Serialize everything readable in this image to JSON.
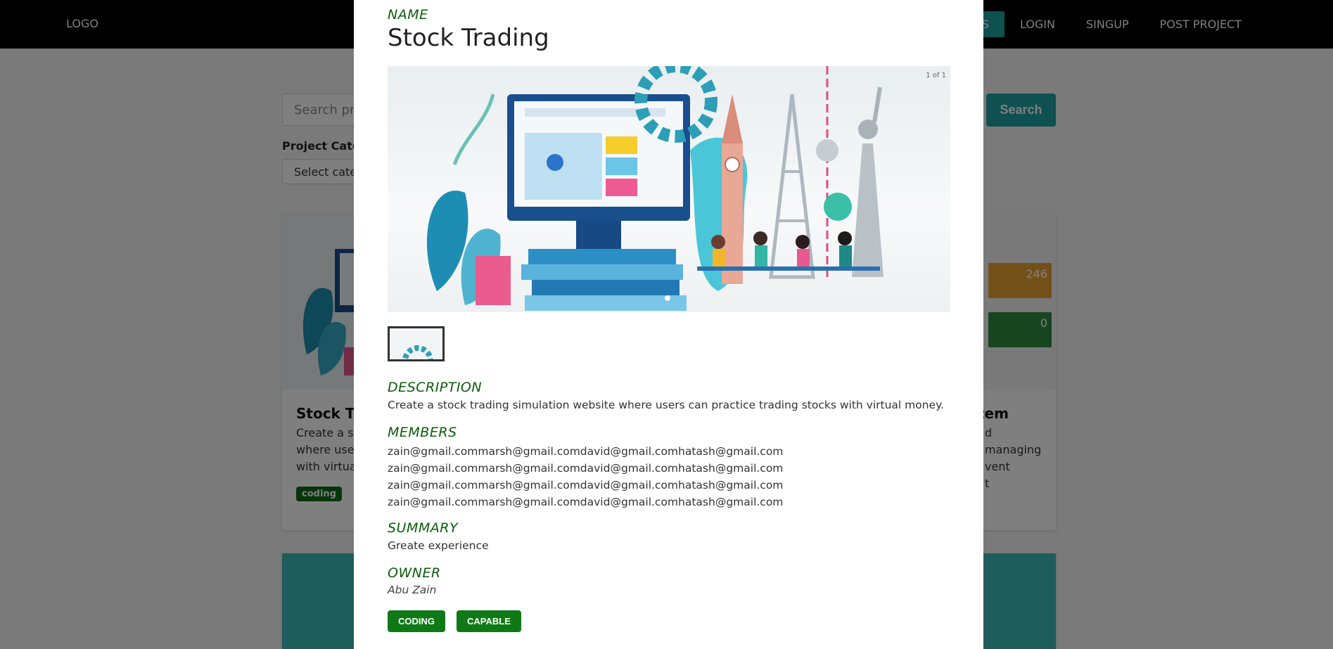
{
  "nav": {
    "logo": "LOGO",
    "active_partial": "TS",
    "links": [
      "LOGIN",
      "SINGUP",
      "POST PROJECT"
    ]
  },
  "search": {
    "placeholder": "Search pro",
    "button": "Search"
  },
  "filter": {
    "label": "Project Catego",
    "select_value": "Select categ"
  },
  "cards": [
    {
      "title": "Stock Tra",
      "text_lines": [
        "Create a sto",
        "where users",
        "with virtual"
      ],
      "tag": "coding"
    },
    {
      "title": "tem",
      "text_lines": [
        "d managing",
        "vent",
        "t"
      ],
      "tiles": [
        "246",
        "0"
      ]
    }
  ],
  "modal": {
    "name_label": "NAME",
    "title": "Stock Trading",
    "slide_counter": "1 of 1",
    "description_label": "DESCRIPTION",
    "description": "Create a stock trading simulation website where users can practice trading stocks with virtual money.",
    "members_label": "MEMBERS",
    "members": [
      "zain@gmail.commarsh@gmail.comdavid@gmail.comhatash@gmail.com",
      "zain@gmail.commarsh@gmail.comdavid@gmail.comhatash@gmail.com",
      "zain@gmail.commarsh@gmail.comdavid@gmail.comhatash@gmail.com",
      "zain@gmail.commarsh@gmail.comdavid@gmail.comhatash@gmail.com"
    ],
    "summary_label": "SUMMARY",
    "summary": "Greate experience",
    "owner_label": "OWNER",
    "owner": "Abu Zain",
    "tags": [
      "CODING",
      "CAPABLE"
    ]
  },
  "colors": {
    "accent": "#1ea0a0",
    "label_green": "#0a5c0a",
    "tag_green": "#0f7a15"
  }
}
